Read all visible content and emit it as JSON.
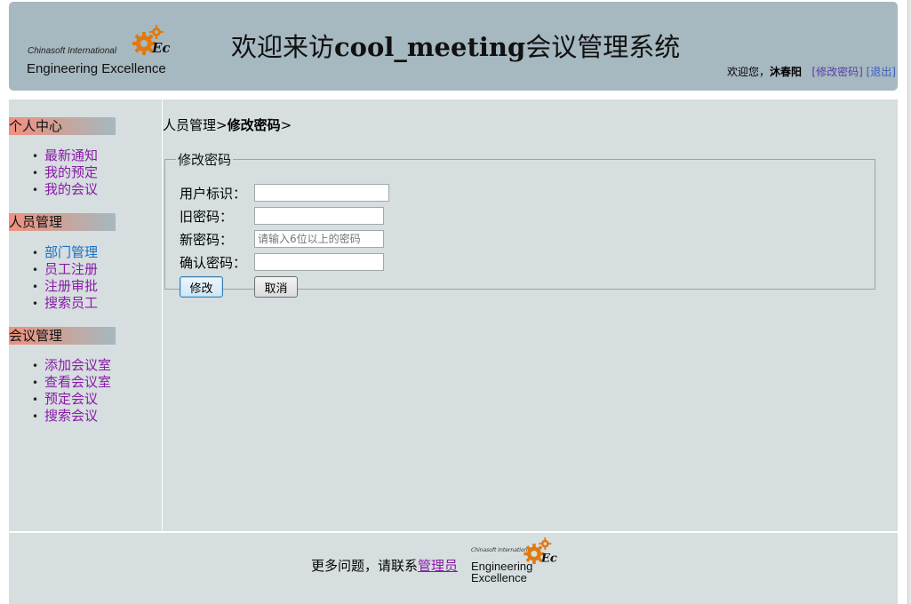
{
  "header": {
    "logo": {
      "line1": "Chinasoft International",
      "line2": "Engineering Excellence",
      "icon": "gear-logo-icon"
    },
    "title_prefix": "欢迎来访",
    "title_brand": "cool_meeting",
    "title_suffix": "会议管理系统",
    "welcome": "欢迎您，",
    "user_name": "沐春阳",
    "change_password_link": "[修改密码]",
    "logout_link": "[退出]"
  },
  "sidebar": {
    "sections": [
      {
        "title": "个人中心",
        "items": [
          "最新通知",
          "我的预定",
          "我的会议"
        ]
      },
      {
        "title": "人员管理",
        "items": [
          "部门管理",
          "员工注册",
          "注册审批",
          "搜索员工"
        ]
      },
      {
        "title": "会议管理",
        "items": [
          "添加会议室",
          "查看会议室",
          "预定会议",
          "搜索会议"
        ]
      }
    ]
  },
  "breadcrumb": {
    "parent": "人员管理>",
    "current": "修改密码",
    "trail": ">"
  },
  "form": {
    "legend": "修改密码",
    "fields": [
      {
        "label": "用户标识：",
        "value": "",
        "placeholder": ""
      },
      {
        "label": "旧密码：",
        "value": "",
        "placeholder": ""
      },
      {
        "label": "新密码：",
        "value": "",
        "placeholder": "请输入6位以上的密码"
      },
      {
        "label": "确认密码：",
        "value": "",
        "placeholder": ""
      }
    ],
    "submit_label": "修改",
    "cancel_label": "取消"
  },
  "footer": {
    "text": "更多问题，请联系",
    "admin_link": "管理员",
    "logo": {
      "line1": "Chinasoft International",
      "line2": "Engineering Excellence"
    }
  },
  "colors": {
    "header_bg": "#a6b8c0",
    "panel_bg": "#d6dedf",
    "link_purple": "#8a1aa8",
    "link_blue": "#1a6fc4",
    "section_gradient_start": "#f0907f"
  }
}
